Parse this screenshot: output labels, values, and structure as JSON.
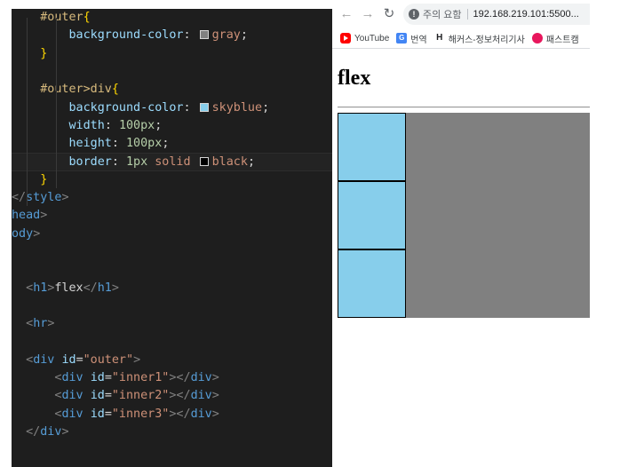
{
  "editor": {
    "lines": [
      [
        {
          "t": "    ",
          "c": "punct"
        },
        {
          "t": "#outer",
          "c": "sel"
        },
        {
          "t": "{",
          "c": "brace"
        }
      ],
      [
        {
          "t": "        ",
          "c": "punct"
        },
        {
          "t": "background-color",
          "c": "prop"
        },
        {
          "t": ": ",
          "c": "punct"
        },
        {
          "swatch": "#808080"
        },
        {
          "t": "gray",
          "c": "val"
        },
        {
          "t": ";",
          "c": "punct"
        }
      ],
      [
        {
          "t": "    ",
          "c": "punct"
        },
        {
          "t": "}",
          "c": "brace"
        }
      ],
      [],
      [
        {
          "t": "    ",
          "c": "punct"
        },
        {
          "t": "#outer>div",
          "c": "sel"
        },
        {
          "t": "{",
          "c": "brace"
        }
      ],
      [
        {
          "t": "        ",
          "c": "punct"
        },
        {
          "t": "background-color",
          "c": "prop"
        },
        {
          "t": ": ",
          "c": "punct"
        },
        {
          "swatch": "#87ceeb"
        },
        {
          "t": "skyblue",
          "c": "val"
        },
        {
          "t": ";",
          "c": "punct"
        }
      ],
      [
        {
          "t": "        ",
          "c": "punct"
        },
        {
          "t": "width",
          "c": "prop"
        },
        {
          "t": ": ",
          "c": "punct"
        },
        {
          "t": "100px",
          "c": "num"
        },
        {
          "t": ";",
          "c": "punct"
        }
      ],
      [
        {
          "t": "        ",
          "c": "punct"
        },
        {
          "t": "height",
          "c": "prop"
        },
        {
          "t": ": ",
          "c": "punct"
        },
        {
          "t": "100px",
          "c": "num"
        },
        {
          "t": ";",
          "c": "punct"
        }
      ],
      [
        {
          "t": "        ",
          "c": "punct"
        },
        {
          "t": "border",
          "c": "prop"
        },
        {
          "t": ": ",
          "c": "punct"
        },
        {
          "t": "1px",
          "c": "num"
        },
        {
          "t": " solid ",
          "c": "val"
        },
        {
          "swatch": "#000000"
        },
        {
          "t": "black",
          "c": "val"
        },
        {
          "t": ";",
          "c": "punct"
        }
      ],
      [
        {
          "t": "    ",
          "c": "punct"
        },
        {
          "t": "}",
          "c": "brace"
        }
      ],
      [
        {
          "t": "</",
          "c": "bracket"
        },
        {
          "t": "style",
          "c": "tag"
        },
        {
          "t": ">",
          "c": "bracket"
        }
      ],
      [
        {
          "t": "head",
          "c": "tag"
        },
        {
          "t": ">",
          "c": "bracket"
        }
      ],
      [
        {
          "t": "ody",
          "c": "tag"
        },
        {
          "t": ">",
          "c": "bracket"
        }
      ],
      [],
      [],
      [
        {
          "t": "  ",
          "c": "punct"
        },
        {
          "t": "<",
          "c": "bracket"
        },
        {
          "t": "h1",
          "c": "tag"
        },
        {
          "t": ">",
          "c": "bracket"
        },
        {
          "t": "flex",
          "c": "punct"
        },
        {
          "t": "</",
          "c": "bracket"
        },
        {
          "t": "h1",
          "c": "tag"
        },
        {
          "t": ">",
          "c": "bracket"
        }
      ],
      [],
      [
        {
          "t": "  ",
          "c": "punct"
        },
        {
          "t": "<",
          "c": "bracket"
        },
        {
          "t": "hr",
          "c": "tag"
        },
        {
          "t": ">",
          "c": "bracket"
        }
      ],
      [],
      [
        {
          "t": "  ",
          "c": "punct"
        },
        {
          "t": "<",
          "c": "bracket"
        },
        {
          "t": "div",
          "c": "tag"
        },
        {
          "t": " ",
          "c": "punct"
        },
        {
          "t": "id",
          "c": "attr"
        },
        {
          "t": "=",
          "c": "punct"
        },
        {
          "t": "\"outer\"",
          "c": "str"
        },
        {
          "t": ">",
          "c": "bracket"
        }
      ],
      [
        {
          "t": "      ",
          "c": "punct"
        },
        {
          "t": "<",
          "c": "bracket"
        },
        {
          "t": "div",
          "c": "tag"
        },
        {
          "t": " ",
          "c": "punct"
        },
        {
          "t": "id",
          "c": "attr"
        },
        {
          "t": "=",
          "c": "punct"
        },
        {
          "t": "\"inner1\"",
          "c": "str"
        },
        {
          "t": "></",
          "c": "bracket"
        },
        {
          "t": "div",
          "c": "tag"
        },
        {
          "t": ">",
          "c": "bracket"
        }
      ],
      [
        {
          "t": "      ",
          "c": "punct"
        },
        {
          "t": "<",
          "c": "bracket"
        },
        {
          "t": "div",
          "c": "tag"
        },
        {
          "t": " ",
          "c": "punct"
        },
        {
          "t": "id",
          "c": "attr"
        },
        {
          "t": "=",
          "c": "punct"
        },
        {
          "t": "\"inner2\"",
          "c": "str"
        },
        {
          "t": "></",
          "c": "bracket"
        },
        {
          "t": "div",
          "c": "tag"
        },
        {
          "t": ">",
          "c": "bracket"
        }
      ],
      [
        {
          "t": "      ",
          "c": "punct"
        },
        {
          "t": "<",
          "c": "bracket"
        },
        {
          "t": "div",
          "c": "tag"
        },
        {
          "t": " ",
          "c": "punct"
        },
        {
          "t": "id",
          "c": "attr"
        },
        {
          "t": "=",
          "c": "punct"
        },
        {
          "t": "\"inner3\"",
          "c": "str"
        },
        {
          "t": "></",
          "c": "bracket"
        },
        {
          "t": "div",
          "c": "tag"
        },
        {
          "t": ">",
          "c": "bracket"
        }
      ],
      [
        {
          "t": "  ",
          "c": "punct"
        },
        {
          "t": "</",
          "c": "bracket"
        },
        {
          "t": "div",
          "c": "tag"
        },
        {
          "t": ">",
          "c": "bracket"
        }
      ]
    ]
  },
  "browser": {
    "nav": {
      "back_icon": "arrow-left-icon",
      "forward_icon": "arrow-right-icon",
      "reload_icon": "reload-icon"
    },
    "omnibox": {
      "security_text": "주의 요함",
      "url": "192.168.219.101:5500..."
    },
    "bookmarks": [
      {
        "label": "YouTube",
        "icon": "youtube-icon"
      },
      {
        "label": "번역",
        "icon": "translate-icon"
      },
      {
        "label": "해커스-정보처리기사",
        "icon": "hackers-icon"
      },
      {
        "label": "패스트캠",
        "icon": "fastcampus-icon"
      }
    ],
    "page": {
      "heading": "flex",
      "outer_color": "#808080",
      "inner_color": "#87ceeb",
      "inner_boxes": [
        "inner1",
        "inner2",
        "inner3"
      ]
    }
  }
}
